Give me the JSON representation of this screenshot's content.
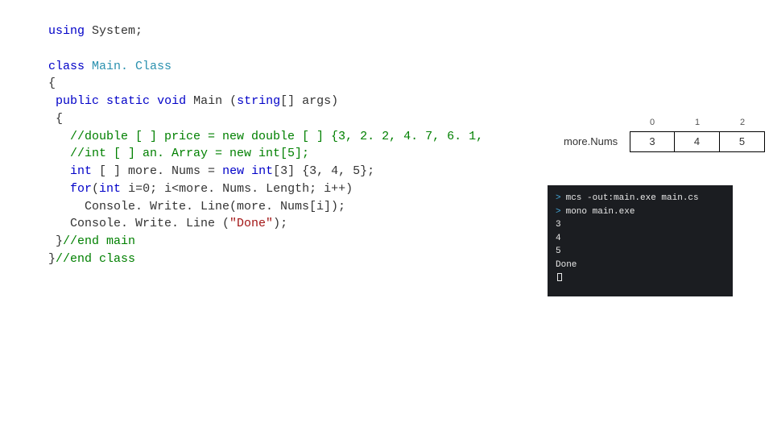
{
  "code": {
    "l1_kw_using": "using",
    "l1_rest": " System;",
    "l3_kw_class": "class",
    "l3_sp": " ",
    "l3_cls": "Main. Class",
    "l4": "{",
    "l5_pre": " ",
    "l5_kw_public": "public",
    "l5_sp1": " ",
    "l5_kw_static": "static",
    "l5_sp2": " ",
    "l5_kw_void": "void",
    "l5_rest": " Main (",
    "l5_t_string": "string",
    "l5_rest2": "[] args)",
    "l6": " {",
    "l7": "   //double [ ] price = new double [ ] {3, 2. 2, 4. 7, 6. 1,",
    "l8": "   //int [ ] an. Array = new int[5];",
    "l9_pre": "   ",
    "l9_t_int": "int",
    "l9_mid": " [ ] more. Nums = ",
    "l9_kw_new": "new",
    "l9_sp": " ",
    "l9_t_int2": "int",
    "l9_rest": "[3] {3, 4, 5};",
    "l10_pre": "   ",
    "l10_kw_for": "for",
    "l10_paren": "(",
    "l10_t_int": "int",
    "l10_rest": " i=0; i<more. Nums. Length; i++)",
    "l11": "     Console. Write. Line(more. Nums[i]);",
    "l12_pre": "   Console. Write. Line (",
    "l12_str": "\"Done\"",
    "l12_end": ");",
    "l13_pre": " }",
    "l13_cm": "//end main",
    "l14_pre": "}",
    "l14_cm": "//end class"
  },
  "diagram": {
    "label": "more.Nums",
    "indices": [
      "0",
      "1",
      "2"
    ],
    "values": [
      "3",
      "4",
      "5"
    ]
  },
  "terminal": {
    "prompt_char": ">",
    "cmd1": "mcs -out:main.exe main.cs",
    "cmd2": "mono main.exe",
    "out1": "3",
    "out2": "4",
    "out3": "5",
    "out4": "Done"
  }
}
